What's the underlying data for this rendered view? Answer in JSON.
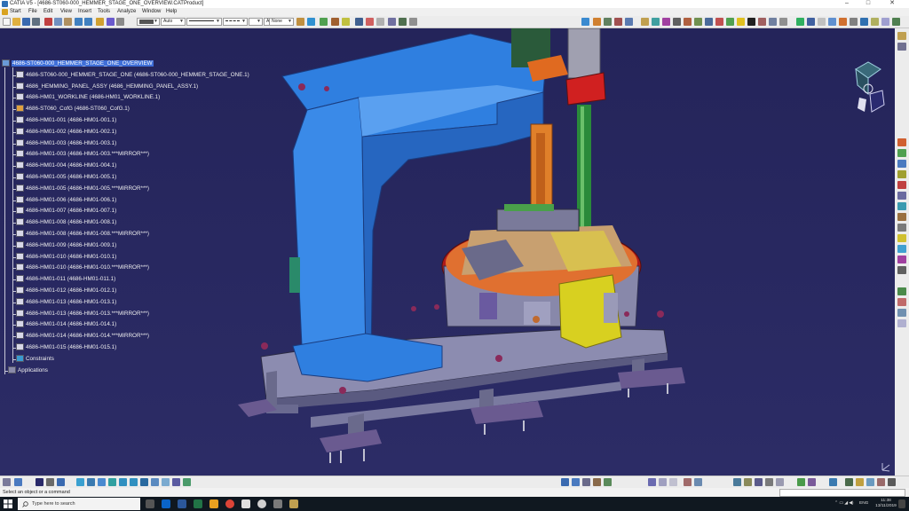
{
  "window": {
    "title": "CATIA V5 - [4686-ST060-000_HEMMER_STAGE_ONE_OVERVIEW.CATProduct]",
    "minimize": "–",
    "maximize": "□",
    "close": "✕"
  },
  "menu": [
    "Start",
    "File",
    "Edit",
    "View",
    "Insert",
    "Tools",
    "Analyze",
    "Window",
    "Help"
  ],
  "toolbar": {
    "color_value": "",
    "transparency_value": "Auto",
    "line_weight_value": "",
    "line_type_value": "",
    "point_value": "",
    "layer_label": "Aut",
    "layer_value": "None"
  },
  "tree": [
    {
      "label": "4686-ST060-000_HEMMER_STAGE_ONE_OVERVIEW",
      "icon": "product-root-icon",
      "selected": true
    },
    {
      "label": "4686-ST060-000_HEMMER_STAGE_ONE (4686-ST060-000_HEMMER_STAGE_ONE.1)",
      "icon": "product-icon"
    },
    {
      "label": "4686_HEMMING_PANEL_ASSY (4686_HEMMING_PANEL_ASSY.1)",
      "icon": "product-icon"
    },
    {
      "label": "4686-HM01_WORKLINE (4686-HM01_WORKLINE.1)",
      "icon": "product-icon"
    },
    {
      "label": "4686-ST060_CofG (4686-ST060_CofG.1)",
      "icon": "part-icon"
    },
    {
      "label": "4686-HM01-001 (4686-HM01-001.1)",
      "icon": "product-icon"
    },
    {
      "label": "4686-HM01-002 (4686-HM01-002.1)",
      "icon": "product-icon"
    },
    {
      "label": "4686-HM01-003 (4686-HM01-003.1)",
      "icon": "product-icon"
    },
    {
      "label": "4686-HM01-003 (4686-HM01-003.***MIRROR***)",
      "icon": "product-icon"
    },
    {
      "label": "4686-HM01-004 (4686-HM01-004.1)",
      "icon": "product-icon"
    },
    {
      "label": "4686-HM01-005 (4686-HM01-005.1)",
      "icon": "product-icon"
    },
    {
      "label": "4686-HM01-005 (4686-HM01-005.***MIRROR***)",
      "icon": "product-icon"
    },
    {
      "label": "4686-HM01-006 (4686-HM01-006.1)",
      "icon": "product-icon"
    },
    {
      "label": "4686-HM01-007 (4686-HM01-007.1)",
      "icon": "product-icon"
    },
    {
      "label": "4686-HM01-008 (4686-HM01-008.1)",
      "icon": "product-icon"
    },
    {
      "label": "4686-HM01-008 (4686-HM01-008.***MIRROR***)",
      "icon": "product-icon"
    },
    {
      "label": "4686-HM01-009 (4686-HM01-009.1)",
      "icon": "product-icon"
    },
    {
      "label": "4686-HM01-010 (4686-HM01-010.1)",
      "icon": "product-icon"
    },
    {
      "label": "4686-HM01-010 (4686-HM01-010.***MIRROR***)",
      "icon": "product-icon"
    },
    {
      "label": "4686-HM01-011 (4686-HM01-011.1)",
      "icon": "product-icon"
    },
    {
      "label": "4686-HM01-012 (4686-HM01-012.1)",
      "icon": "product-icon"
    },
    {
      "label": "4686-HM01-013 (4686-HM01-013.1)",
      "icon": "product-icon"
    },
    {
      "label": "4686-HM01-013 (4686-HM01-013.***MIRROR***)",
      "icon": "product-icon"
    },
    {
      "label": "4686-HM01-014 (4686-HM01-014.1)",
      "icon": "product-icon"
    },
    {
      "label": "4686-HM01-014 (4686-HM01-014.***MIRROR***)",
      "icon": "product-icon"
    },
    {
      "label": "4686-HM01-015 (4686-HM01-015.1)",
      "icon": "product-icon"
    },
    {
      "label": "Constraints",
      "icon": "constraints-icon"
    },
    {
      "label": "Applications",
      "icon": "applications-icon"
    }
  ],
  "status": {
    "message": "Select an object or a command"
  },
  "taskbar": {
    "search_placeholder": "Type here to search",
    "language": "ENG",
    "time": "11:38",
    "date": "13/11/2019"
  },
  "colors": {
    "viewport_bg": "#262659",
    "frame_blue": "#2f7fe0",
    "selection": "#3f6fd8",
    "tree_text": "#f0f0f0"
  }
}
